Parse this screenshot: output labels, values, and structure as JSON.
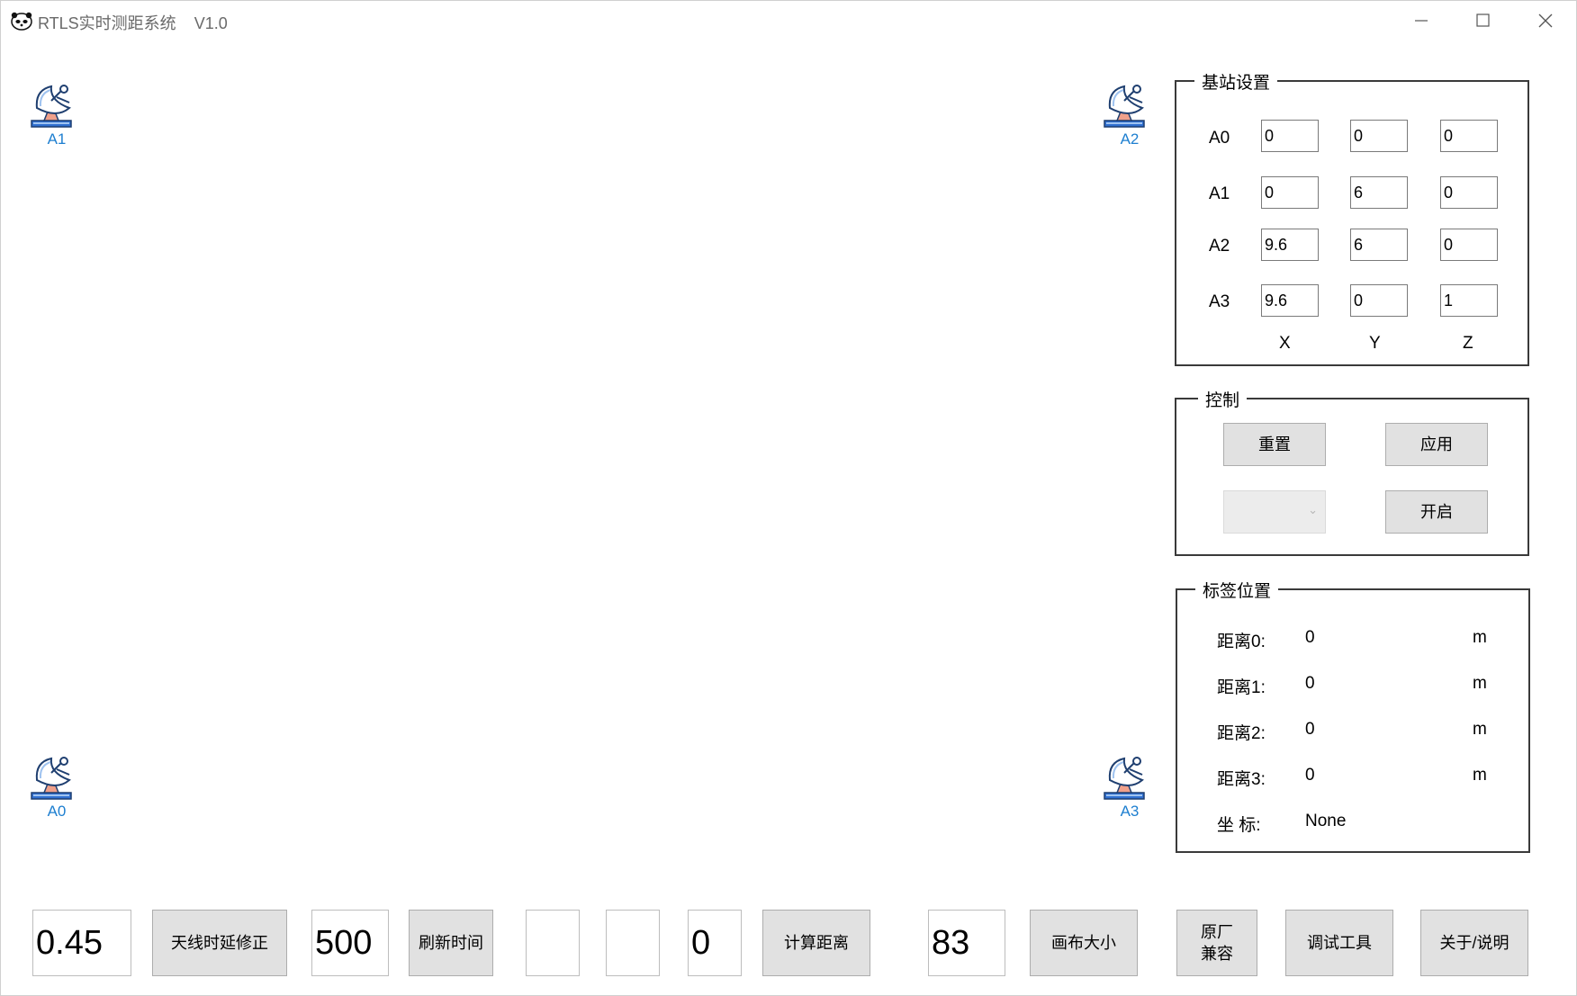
{
  "window": {
    "title": "RTLS实时测距系统    V1.0"
  },
  "anchors": [
    {
      "id": "a1",
      "label": "A1"
    },
    {
      "id": "a2",
      "label": "A2"
    },
    {
      "id": "a0",
      "label": "A0"
    },
    {
      "id": "a3",
      "label": "A3"
    }
  ],
  "base_settings": {
    "title": "基站设置",
    "rows": [
      {
        "label": "A0",
        "x": "0",
        "y": "0",
        "z": "0"
      },
      {
        "label": "A1",
        "x": "0",
        "y": "6",
        "z": "0"
      },
      {
        "label": "A2",
        "x": "9.6",
        "y": "6",
        "z": "0"
      },
      {
        "label": "A3",
        "x": "9.6",
        "y": "0",
        "z": "1"
      }
    ],
    "axis_x": "X",
    "axis_y": "Y",
    "axis_z": "Z"
  },
  "control": {
    "title": "控制",
    "reset_label": "重置",
    "apply_label": "应用",
    "open_label": "开启",
    "port_select_value": ""
  },
  "tag_position": {
    "title": "标签位置",
    "rows": [
      {
        "label": "距离0:",
        "value": "0",
        "unit": "m"
      },
      {
        "label": "距离1:",
        "value": "0",
        "unit": "m"
      },
      {
        "label": "距离2:",
        "value": "0",
        "unit": "m"
      },
      {
        "label": "距离3:",
        "value": "0",
        "unit": "m"
      }
    ],
    "coord_label": "坐 标:",
    "coord_value": "None"
  },
  "bottom": {
    "antenna_delay_value": "0.45",
    "antenna_delay_button": "天线时延修正",
    "refresh_value": "500",
    "refresh_button": "刷新时间",
    "blank1_value": "",
    "blank2_value": "",
    "calc_value": "0",
    "calc_button": "计算距离",
    "canvas_value": "83",
    "canvas_button": "画布大小",
    "compat_line1": "原厂",
    "compat_line2": "兼容",
    "debug_button": "调试工具",
    "about_button": "关于/说明"
  },
  "colors": {
    "anchor_label": "#1e7fd0",
    "button_bg": "#e1e1e1",
    "group_border": "#3a3a3a"
  },
  "icons": {
    "app": "panda-icon",
    "anchor": "satellite-dish-icon",
    "minimize": "minimize-icon",
    "maximize": "maximize-icon",
    "close": "close-icon"
  }
}
